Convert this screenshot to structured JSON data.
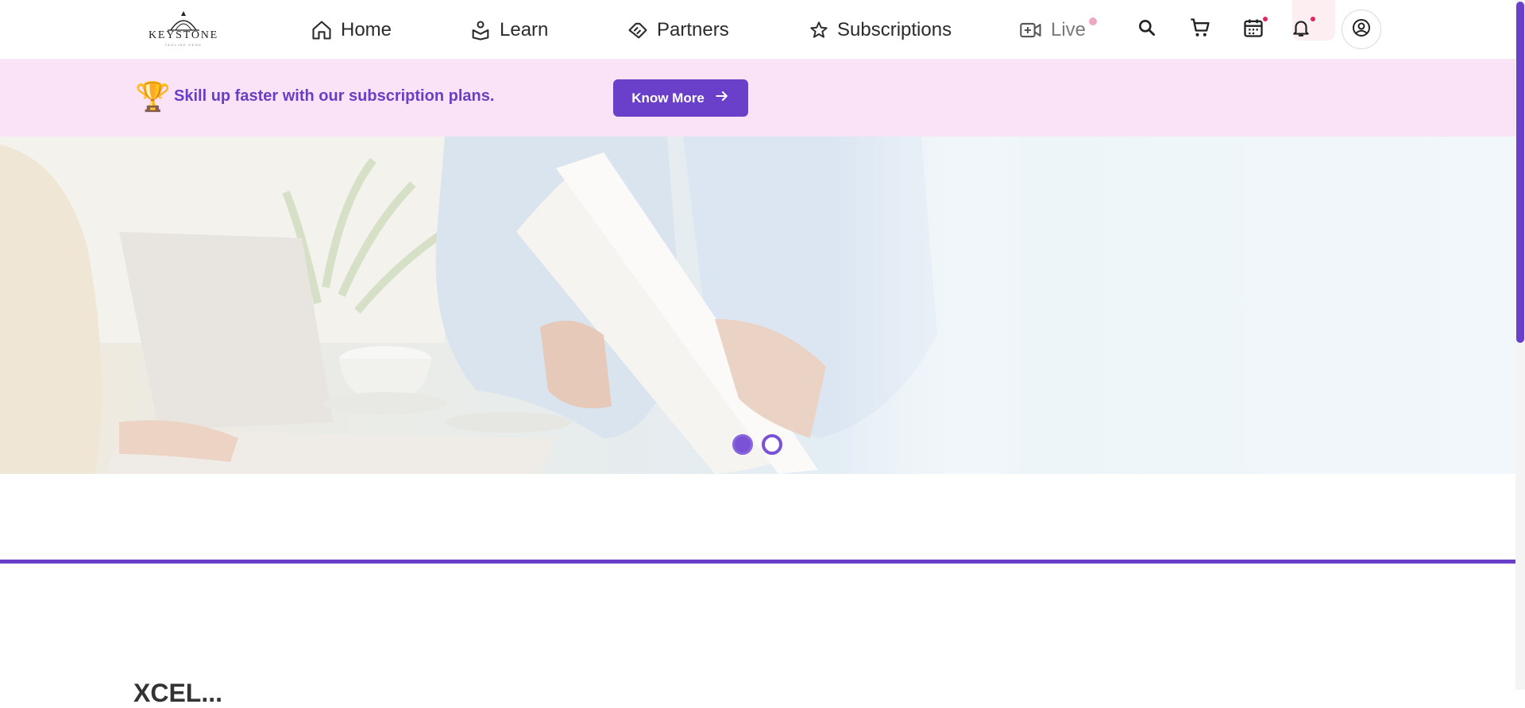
{
  "header": {
    "logo": {
      "word": "KEYSTONE",
      "tagline": "TAGLINE HERE"
    },
    "nav": [
      {
        "label": "Home",
        "icon": "home-icon"
      },
      {
        "label": "Learn",
        "icon": "learn-icon"
      },
      {
        "label": "Partners",
        "icon": "handshake-icon"
      },
      {
        "label": "Subscriptions",
        "icon": "star-icon"
      },
      {
        "label": "Live",
        "icon": "video-plus-icon"
      }
    ],
    "icons": [
      "search-icon",
      "cart-icon",
      "calendar-icon",
      "bell-icon",
      "account-icon"
    ]
  },
  "promo": {
    "text": "Skill up faster with our subscription plans.",
    "button_label": "Know More"
  },
  "hero": {
    "slides": 2,
    "active_slide": 1
  },
  "section": {
    "title": "XCEL..."
  },
  "colors": {
    "accent": "#6a3fc9",
    "promo_bg": "#fbe3f7",
    "notification_dot": "#e0245e"
  }
}
